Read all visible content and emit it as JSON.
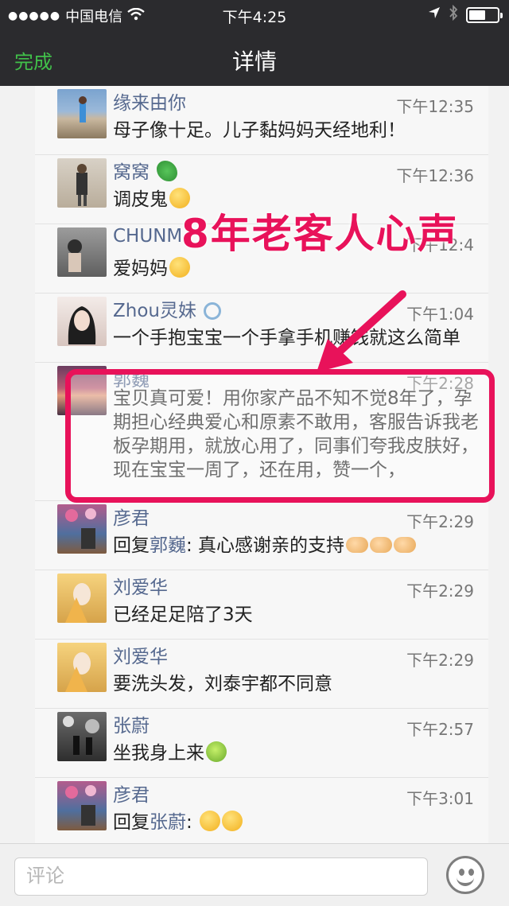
{
  "status_bar": {
    "signal_dots": "●●●●●",
    "carrier": "中国电信",
    "time": "下午4:25"
  },
  "header": {
    "done_label": "完成",
    "title": "详情"
  },
  "annotation": {
    "overlay_text": "8年老客人心声"
  },
  "comments": [
    {
      "name": "缘来由你",
      "time": "下午12:35",
      "text": "母子像十足。儿子黏妈妈天经地利！"
    },
    {
      "name": "窝窝",
      "time": "下午12:36",
      "text": "调皮鬼"
    },
    {
      "name": "CHUNM",
      "time": "下午12:4",
      "text": "爱妈妈"
    },
    {
      "name": "Zhou灵妹",
      "time": "下午1:04",
      "text": "一个手抱宝宝一个手拿手机赚钱就这么简单"
    },
    {
      "name": "郭巍",
      "time": "下午2:28",
      "text": "宝贝真可爱！用你家产品不知不觉8年了，孕期担心经典爱心和原素不敢用，客服告诉我老板孕期用，就放心用了，同事们夸我皮肤好，现在宝宝一周了，还在用，赞一个，"
    },
    {
      "name": "彦君",
      "time": "下午2:29",
      "reply_prefix": "回复",
      "reply_to": "郭巍",
      "text": ": 真心感谢亲的支持"
    },
    {
      "name": "刘爱华",
      "time": "下午2:29",
      "text": "已经足足陪了3天"
    },
    {
      "name": "刘爱华",
      "time": "下午2:29",
      "text": "要洗头发，刘泰宇都不同意"
    },
    {
      "name": "张蔚",
      "time": "下午2:57",
      "text": "坐我身上来"
    },
    {
      "name": "彦君",
      "time": "下午3:01",
      "reply_prefix": "回复",
      "reply_to": "张蔚",
      "text": ": "
    }
  ],
  "input_bar": {
    "placeholder": "评论"
  },
  "colors": {
    "accent_green": "#41c04a",
    "name_blue": "#56698f",
    "highlight_red": "#e8125a",
    "header_bg": "#2b2b2e"
  },
  "icons": {
    "wifi": "wifi-icon",
    "location": "location-arrow-icon",
    "bluetooth": "bluetooth-icon",
    "battery": "battery-icon",
    "emoji": "smiley-icon"
  }
}
